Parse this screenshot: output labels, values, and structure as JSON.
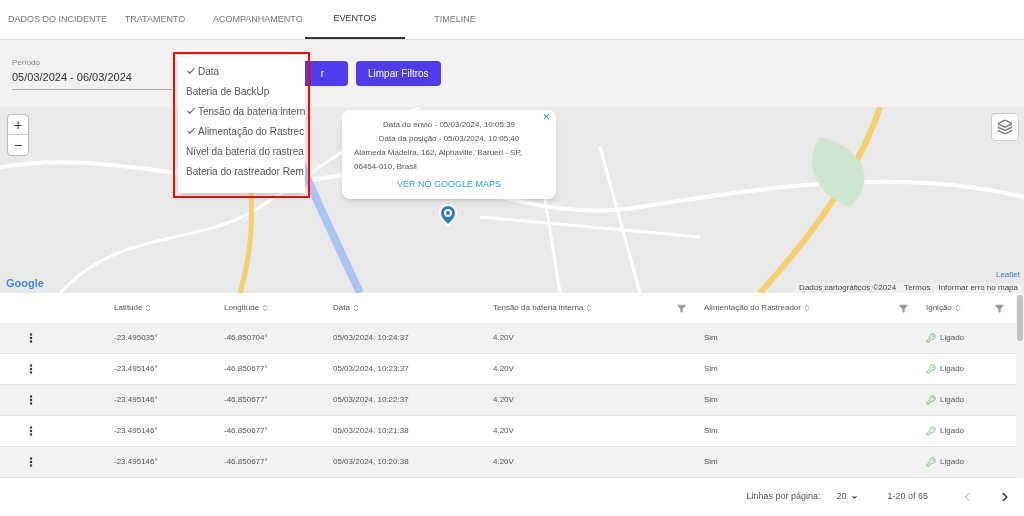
{
  "tabs": [
    {
      "label": "DADOS DO INCIDENTE",
      "selected": false
    },
    {
      "label": "TRATAMENTO",
      "selected": false
    },
    {
      "label": "ACOMPANHAMENTO",
      "selected": false
    },
    {
      "label": "EVENTOS",
      "selected": true
    },
    {
      "label": "TIMELINE",
      "selected": false
    }
  ],
  "filters": {
    "period_label": "Período",
    "period_value": "05/03/2024 - 06/03/2024",
    "filter_button": "r",
    "clear_button": "Limpar Filtros"
  },
  "column_menu": {
    "items": [
      {
        "label": "Data",
        "checked": true
      },
      {
        "label": "Bateria de BackUp",
        "checked": false
      },
      {
        "label": "Tensão da bateria intern",
        "checked": true
      },
      {
        "label": "Alimentação do Rastrec",
        "checked": true
      },
      {
        "label": "Nível da bateria do rastrea",
        "checked": false
      },
      {
        "label": "Bateria do rastreador Rem",
        "checked": false
      }
    ]
  },
  "map": {
    "zoom_in": "+",
    "zoom_out": "−",
    "logo": "Google",
    "popup": {
      "close": "×",
      "lines": [
        "Data do envio - 05/03/2024, 10:05:39",
        "Data da posição - 05/03/2024, 10:05:40"
      ],
      "address": "Alameda Madeira, 162, Alphaville, Barueri - SP, 06454-010, Brasil",
      "link": "VER NO GOOGLE MAPS"
    },
    "attribution": {
      "leaflet": "Leaflet",
      "data": "Dados cartográficos ©2024",
      "terms": "Termos",
      "report": "Informar erro no mapa"
    }
  },
  "table": {
    "columns": [
      {
        "label": "Latitude",
        "filter": false
      },
      {
        "label": "Longitude",
        "filter": false
      },
      {
        "label": "Data",
        "filter": false
      },
      {
        "label": "Tensão da bateria interna",
        "filter": true
      },
      {
        "label": "Alimentação do Rastreador",
        "filter": true
      },
      {
        "label": "Ignição",
        "filter": true
      }
    ],
    "rows": [
      {
        "cells": [
          "-23.495035°",
          "-46.850704°",
          "05/03/2024, 10:24:37",
          "4.20V",
          "Sim",
          "Ligado"
        ]
      },
      {
        "cells": [
          "-23.495146°",
          "-46.850677°",
          "05/03/2024, 10:23:37",
          "4.20V",
          "Sim",
          "Ligado"
        ]
      },
      {
        "cells": [
          "-23.495146°",
          "-46.850677°",
          "05/03/2024, 10:22:37",
          "4.20V",
          "Sim",
          "Ligado"
        ]
      },
      {
        "cells": [
          "-23.495146°",
          "-46.850677°",
          "05/03/2024, 10:21:38",
          "4.20V",
          "Sim",
          "Ligado"
        ]
      },
      {
        "cells": [
          "-23.495146°",
          "-46.850677°",
          "05/03/2024, 10:20:38",
          "4.20V",
          "Sim",
          "Ligado"
        ]
      }
    ]
  },
  "pagination": {
    "rows_label": "Linhas por página:",
    "rows_value": "20",
    "range": "1-20 of 65",
    "prev_disabled": true,
    "next_disabled": false
  }
}
